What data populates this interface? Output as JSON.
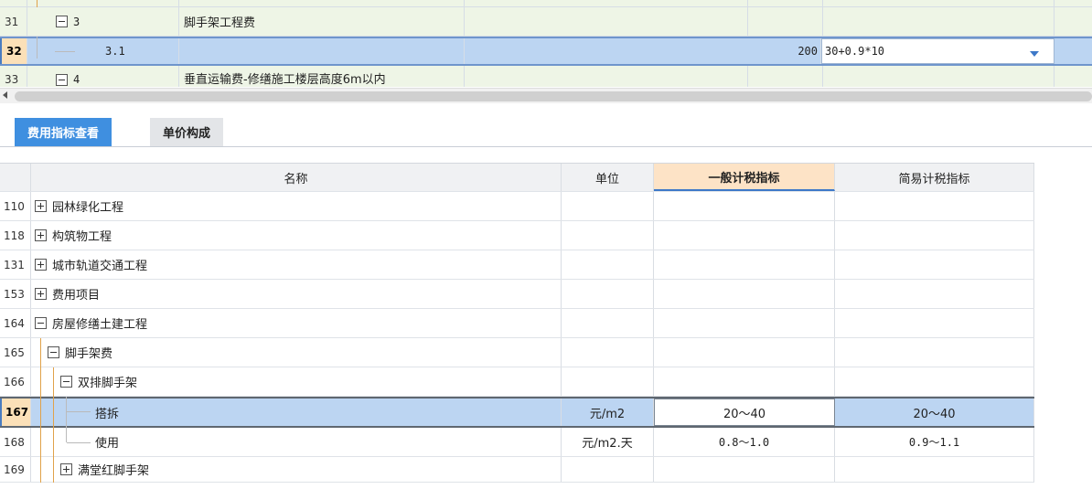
{
  "upper_grid": {
    "rows": [
      {
        "num": "",
        "code": "",
        "name": ""
      },
      {
        "num": "31",
        "code": "3",
        "name": "脚手架工程费",
        "toggle": "minus"
      },
      {
        "num": "32",
        "code": "3.1",
        "name": "",
        "qty": "200",
        "expr": "30+0.9*10"
      },
      {
        "num": "33",
        "code": "4",
        "name": "垂直运输费-修缮施工楼层高度6m以内",
        "toggle": "minus"
      }
    ]
  },
  "tabs": [
    {
      "label": "费用指标查看"
    },
    {
      "label": "单价构成"
    }
  ],
  "index_table": {
    "headers": {
      "name": "名称",
      "unit": "单位",
      "general": "一般计税指标",
      "simple": "简易计税指标"
    },
    "rows": [
      {
        "num": "110",
        "name": "园林绿化工程",
        "toggle": "plus",
        "unit": "",
        "general": "",
        "simple": ""
      },
      {
        "num": "118",
        "name": "构筑物工程",
        "toggle": "plus",
        "unit": "",
        "general": "",
        "simple": ""
      },
      {
        "num": "131",
        "name": "城市轨道交通工程",
        "toggle": "plus",
        "unit": "",
        "general": "",
        "simple": ""
      },
      {
        "num": "153",
        "name": "费用项目",
        "toggle": "plus",
        "unit": "",
        "general": "",
        "simple": ""
      },
      {
        "num": "164",
        "name": "房屋修缮土建工程",
        "toggle": "minus",
        "unit": "",
        "general": "",
        "simple": ""
      },
      {
        "num": "165",
        "name": "脚手架费",
        "toggle": "minus",
        "unit": "",
        "general": "",
        "simple": ""
      },
      {
        "num": "166",
        "name": "双排脚手架",
        "toggle": "minus",
        "unit": "",
        "general": "",
        "simple": ""
      },
      {
        "num": "167",
        "name": "搭拆",
        "unit": "元/m2",
        "general": "20～40",
        "simple": "20～40"
      },
      {
        "num": "168",
        "name": "使用",
        "unit": "元/m2.天",
        "general": "0.8～1.0",
        "simple": "0.9～1.1"
      },
      {
        "num": "169",
        "name": "满堂红脚手架",
        "toggle": "plus",
        "unit": "",
        "general": "",
        "simple": ""
      }
    ]
  },
  "colors": {
    "accent": "#3f8fe0",
    "selection": "#bcd5f2",
    "row_green": "#eef5e6",
    "header_highlight": "#fde3c6"
  }
}
